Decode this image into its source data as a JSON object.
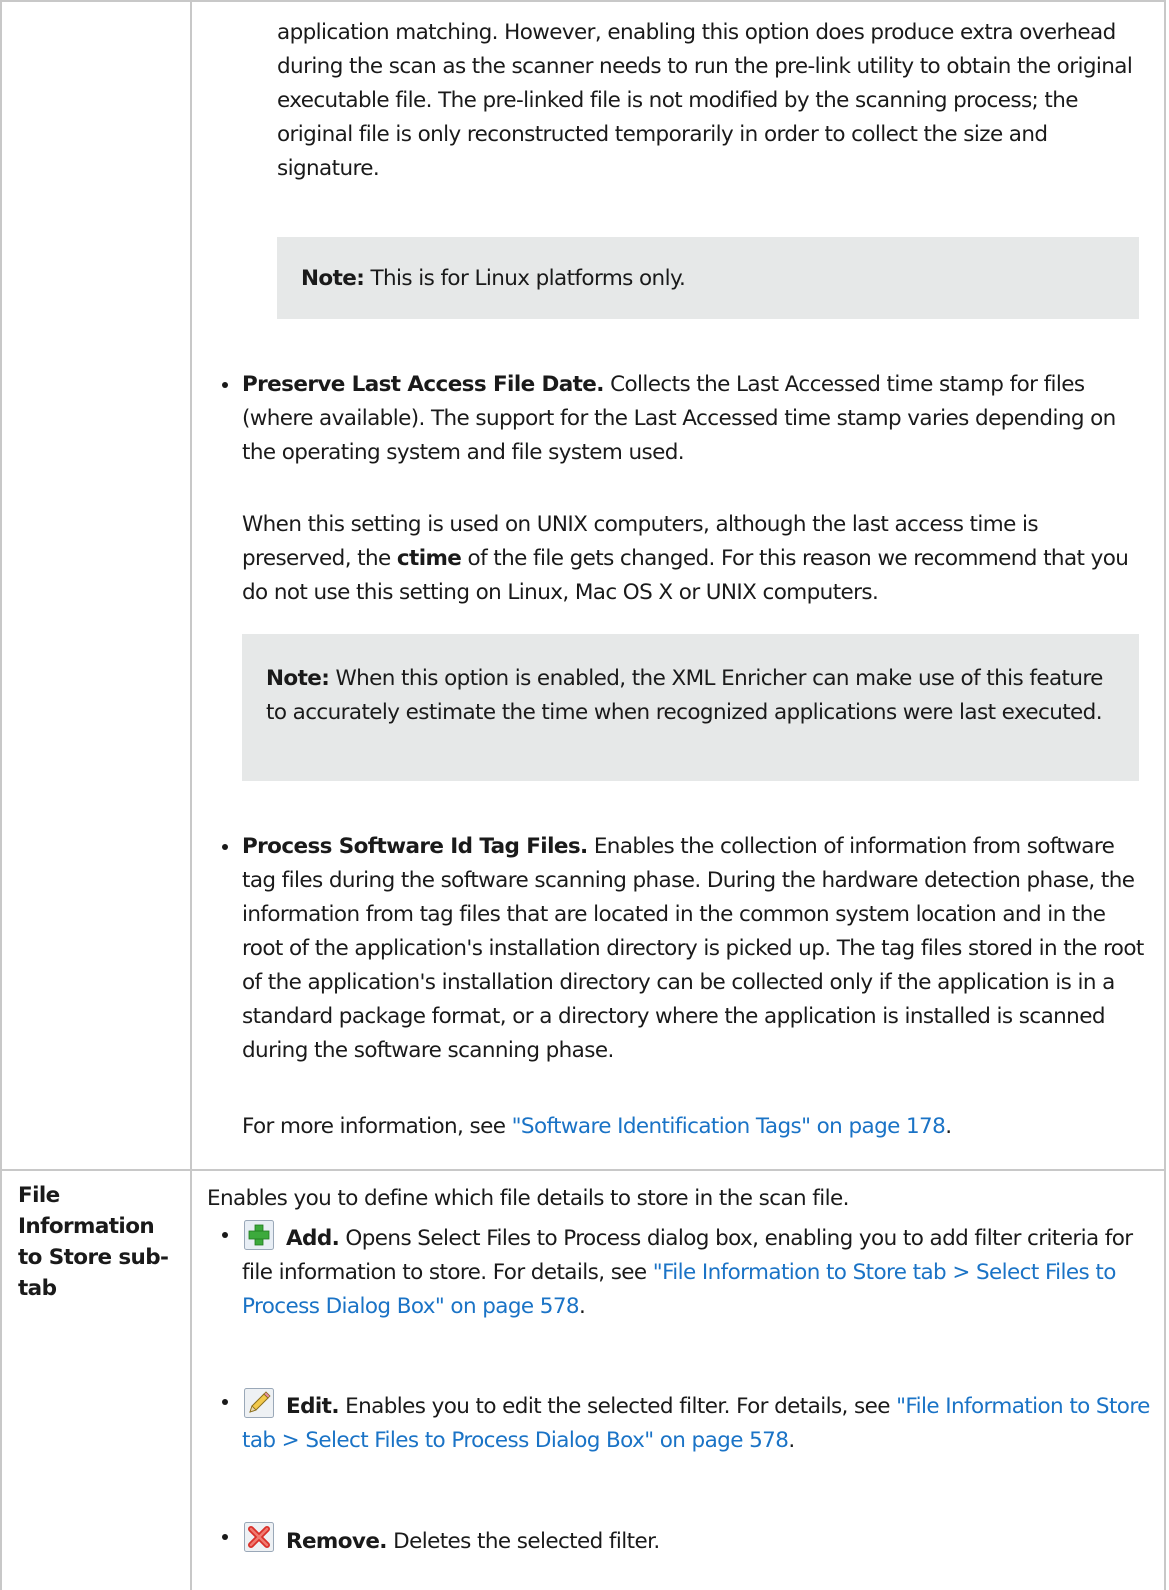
{
  "row1": {
    "continuation_text": "application matching. However, enabling this option does produce extra overhead during the scan as the scanner needs to run the pre-link utility to obtain the original executable file. The pre-linked file is not modified by the scanning process; the original file is only reconstructed temporarily in order to collect the size and signature.",
    "note1": {
      "label": "Note:",
      "text": " This is for Linux platforms only."
    },
    "preserve": {
      "title": "Preserve Last Access File Date.",
      "text": " Collects the Last Accessed time stamp for files (where available). The support for the Last Accessed time stamp varies depending on the operating system and file system used.",
      "para2_a": "When this setting is used on UNIX computers, although the last access time is preserved, the ",
      "para2_bold": "ctime",
      "para2_b": " of the file gets changed. For this reason we recommend that you do not use this setting on Linux, Mac OS X or UNIX computers."
    },
    "note2": {
      "label": "Note:",
      "text": " When this option is enabled, the XML Enricher can make use of this feature to accurately estimate the time when recognized applications were last executed."
    },
    "process": {
      "title": "Process Software Id Tag Files.",
      "text": " Enables the collection of information from software tag files during the software scanning phase. During the hardware detection phase, the information from tag files that are located in the common system location and in the root of the application's installation directory is picked up. The tag files stored in the root of the application's installation directory can be collected only if the application is in a standard package format, or a directory where the application is installed is scanned during the software scanning phase.",
      "more_prefix": "For more information, see ",
      "more_link": "\"Software Identification Tags\" on page 178",
      "more_suffix": "."
    }
  },
  "row2": {
    "label": "File Information to Store sub-tab",
    "intro": "Enables you to define which file details to store in the scan file.",
    "add": {
      "icon": "add-icon",
      "title": "Add.",
      "text": " Opens Select Files to Process dialog box, enabling you to add filter criteria for file information to store. For details, see ",
      "link": "\"File Information to Store tab > Select Files to Process Dialog Box\" on page 578",
      "suffix": "."
    },
    "edit": {
      "icon": "pencil-icon",
      "title": "Edit.",
      "text": " Enables you to edit the selected filter. For details, see ",
      "link": "\"File Information to Store tab > Select Files to Process Dialog Box\" on page 578",
      "suffix": "."
    },
    "remove": {
      "icon": "remove-icon",
      "title": "Remove.",
      "text": " Deletes the selected filter."
    }
  },
  "colors": {
    "link": "#1a73c6",
    "note_bg": "#e6e8e8",
    "border": "#c8c8c8"
  }
}
